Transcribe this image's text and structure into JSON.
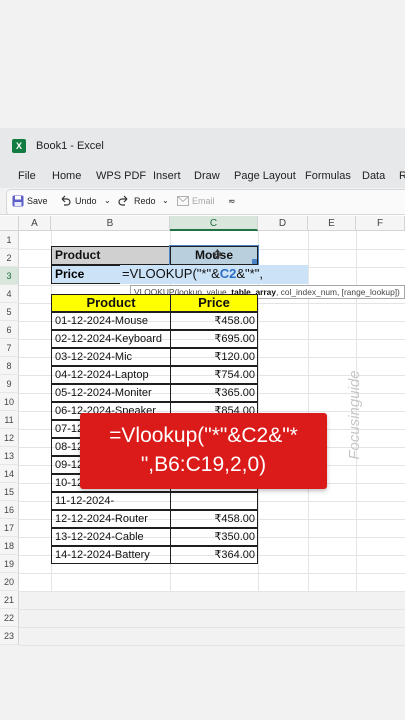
{
  "window": {
    "title": "Book1  -  Excel"
  },
  "menu": [
    "File",
    "Home",
    "WPS PDF",
    "Insert",
    "Draw",
    "Page Layout",
    "Formulas",
    "Data",
    "R"
  ],
  "toolbar": {
    "save": "Save",
    "undo": "Undo",
    "redo": "Redo",
    "email": "Email"
  },
  "columns": [
    "A",
    "B",
    "C",
    "D",
    "E",
    "F"
  ],
  "rows": [
    "1",
    "2",
    "3",
    "4",
    "5",
    "6",
    "7",
    "8",
    "9",
    "10",
    "11",
    "12",
    "13",
    "14",
    "15",
    "16",
    "17",
    "18",
    "19",
    "20",
    "21",
    "22",
    "23"
  ],
  "lookup": {
    "product_label": "Product",
    "product_value": "Mouse",
    "price_label": "Price",
    "formula_prefix": "=VLOOKUP(\"*\"&",
    "formula_ref": "C2",
    "formula_suffix": "&\"*\","
  },
  "tooltip": {
    "fn": "VLOOKUP(lookup_value, ",
    "arg_bold": "table_array",
    "rest": ", col_index_num, [range_lookup])"
  },
  "table": {
    "headers": [
      "Product",
      "Price"
    ],
    "rows": [
      [
        "01-12-2024-Mouse",
        "₹458.00"
      ],
      [
        "02-12-2024-Keyboard",
        "₹695.00"
      ],
      [
        "03-12-2024-Mic",
        "₹120.00"
      ],
      [
        "04-12-2024-Laptop",
        "₹754.00"
      ],
      [
        "05-12-2024-Moniter",
        "₹365.00"
      ],
      [
        "06-12-2024-Speaker",
        "₹854.00"
      ],
      [
        "07-12-2024-",
        ""
      ],
      [
        "08-12-2024-",
        ""
      ],
      [
        "09-12-2024-",
        ""
      ],
      [
        "10-12-2024-",
        ""
      ],
      [
        "11-12-2024-",
        ""
      ],
      [
        "12-12-2024-Router",
        "₹458.00"
      ],
      [
        "13-12-2024-Cable",
        "₹350.00"
      ],
      [
        "14-12-2024-Battery",
        "₹364.00"
      ]
    ]
  },
  "callout": {
    "line1": "=Vlookup(\"*\"&C2&\"*",
    "line2": "\",B6:C19,2,0)"
  },
  "watermark": "Focusinguide",
  "colors": {
    "excel_green": "#217346",
    "header_yellow": "#ffff00",
    "callout_red": "#db1a1a",
    "selection_blue": "#cce3f7"
  }
}
